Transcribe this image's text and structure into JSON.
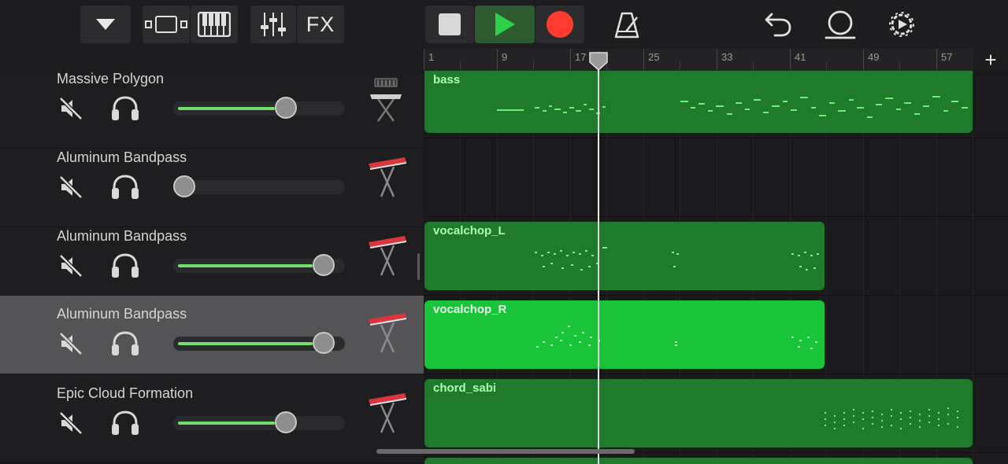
{
  "toolbar": {
    "fx_label": "FX",
    "icons": [
      "tracks-dropdown-icon",
      "track-view-icon",
      "keyboard-icon",
      "mixer-icon",
      "stop-icon",
      "play-icon",
      "record-icon",
      "metronome-icon",
      "undo-icon",
      "loop-icon",
      "settings-icon"
    ],
    "colors": {
      "play": "#2fd14a",
      "record": "#ff3b30"
    }
  },
  "ruler": {
    "markers": [
      "1",
      "9",
      "17",
      "25",
      "33",
      "41",
      "49",
      "57"
    ],
    "add_label": "+"
  },
  "tracks": [
    {
      "name": "Massive Polygon",
      "volume": 0.68,
      "instrument": "keyboard-stand",
      "selected": false
    },
    {
      "name": "Aluminum Bandpass",
      "volume": 0.0,
      "instrument": "red-synth",
      "selected": false
    },
    {
      "name": "Aluminum Bandpass",
      "volume": 0.93,
      "instrument": "red-synth",
      "selected": false
    },
    {
      "name": "Aluminum Bandpass",
      "volume": 0.93,
      "instrument": "red-synth",
      "selected": true
    },
    {
      "name": "Epic Cloud Formation",
      "volume": 0.68,
      "instrument": "red-synth",
      "selected": false
    }
  ],
  "regions": [
    {
      "name": "bass",
      "track": 0,
      "selected": false
    },
    {
      "name": "vocalchop_L",
      "track": 2,
      "selected": false
    },
    {
      "name": "vocalchop_R",
      "track": 3,
      "selected": true
    },
    {
      "name": "chord_sabi",
      "track": 4,
      "selected": false
    }
  ]
}
